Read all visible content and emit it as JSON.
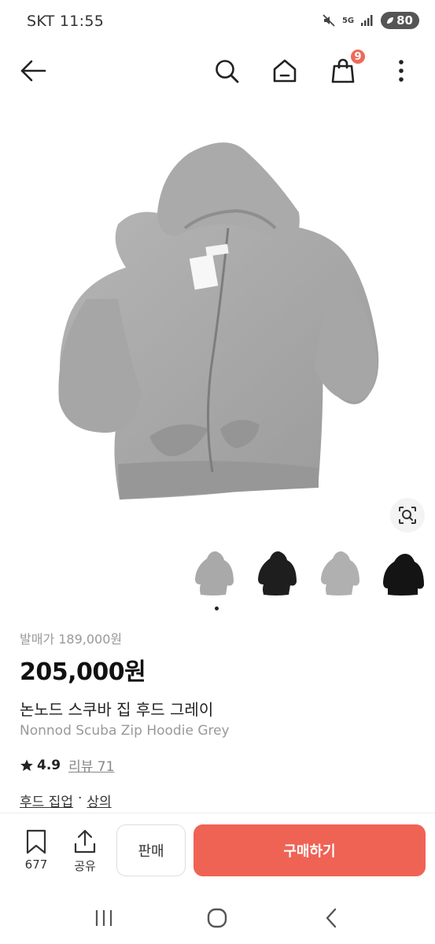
{
  "status_bar": {
    "carrier_time": "SKT 11:55",
    "network": "5G",
    "battery": "80"
  },
  "header": {
    "cart_count": "9",
    "icons": [
      "back-arrow-icon",
      "search-icon",
      "home-icon",
      "shopping-bag-icon",
      "more-vertical-icon"
    ]
  },
  "gallery": {
    "thumbnails": [
      "grey-hoodie",
      "black-hoodie",
      "grey-hoodie",
      "black-hoodie"
    ]
  },
  "product": {
    "retail_price": "발매가 189,000원",
    "price": "205,000원",
    "name_ko": "논노드 스쿠바 집 후드 그레이",
    "name_en": "Nonnod Scuba Zip Hoodie Grey",
    "rating": "4.9",
    "reviews": "리뷰 71",
    "category_1": "후드 집업",
    "separator": "·",
    "category_2": "상의"
  },
  "bottom_bar": {
    "wish_count": "677",
    "share_label": "공유",
    "sell_label": "판매",
    "buy_label": "구매하기"
  },
  "colors": {
    "accent": "#ef6355",
    "badge": "#ee6a5a"
  }
}
